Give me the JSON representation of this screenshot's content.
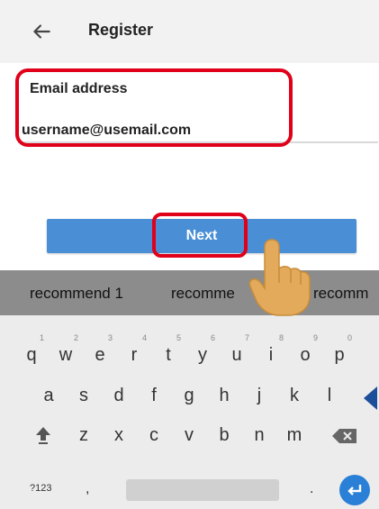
{
  "header": {
    "title": "Register",
    "back_icon": "arrow-left-icon"
  },
  "email": {
    "label": "Email address",
    "value": "username@usemail.com"
  },
  "next_button": {
    "label": "Next",
    "color": "#4a8fd6"
  },
  "highlight_color": "#e0001a",
  "suggestions": [
    "recommend 1",
    "recomme",
    "recomm"
  ],
  "keyboard": {
    "row1": [
      {
        "key": "q",
        "hint": "1"
      },
      {
        "key": "w",
        "hint": "2"
      },
      {
        "key": "e",
        "hint": "3"
      },
      {
        "key": "r",
        "hint": "4"
      },
      {
        "key": "t",
        "hint": "5"
      },
      {
        "key": "y",
        "hint": "6"
      },
      {
        "key": "u",
        "hint": "7"
      },
      {
        "key": "i",
        "hint": "8"
      },
      {
        "key": "o",
        "hint": "9"
      },
      {
        "key": "p",
        "hint": "0"
      }
    ],
    "row2": [
      "a",
      "s",
      "d",
      "f",
      "g",
      "h",
      "j",
      "k",
      "l"
    ],
    "row3": [
      "z",
      "x",
      "c",
      "v",
      "b",
      "n",
      "m"
    ],
    "mode_key": "?123",
    "comma_key": ",",
    "period_key": "."
  }
}
